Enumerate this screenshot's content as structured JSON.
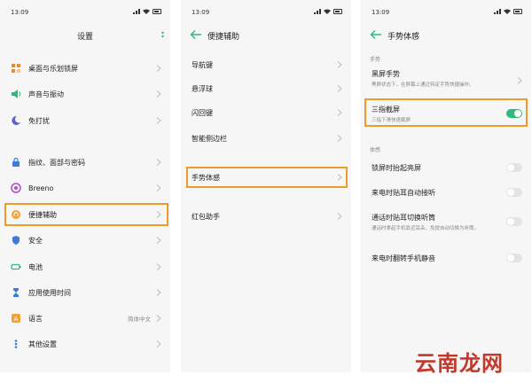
{
  "status": {
    "time": "13:09"
  },
  "screen1": {
    "title": "设置",
    "items": [
      {
        "label": "桌面与乐划锁屏",
        "icon": "desktop-icon",
        "color": "#f08a2c"
      },
      {
        "label": "声音与振动",
        "icon": "sound-icon",
        "color": "#2fb97b"
      },
      {
        "label": "免打扰",
        "icon": "moon-icon",
        "color": "#5a64c8"
      },
      {
        "label": "指纹、面部与密码",
        "icon": "lock-icon",
        "color": "#3d7bd9"
      },
      {
        "label": "Breeno",
        "icon": "breeno-icon",
        "color": "#b34cc6"
      },
      {
        "label": "便捷辅助",
        "icon": "assist-icon",
        "color": "#f0a13a"
      },
      {
        "label": "安全",
        "icon": "shield-icon",
        "color": "#3d7bd9"
      },
      {
        "label": "电池",
        "icon": "battery-icon",
        "color": "#2fb97b"
      },
      {
        "label": "应用使用时间",
        "icon": "hourglass-icon",
        "color": "#3d7bd9"
      },
      {
        "label": "语言",
        "icon": "language-icon",
        "color": "#f0a13a",
        "value": "简体中文"
      },
      {
        "label": "其他设置",
        "icon": "dots-icon",
        "color": "#3d7bd9"
      }
    ]
  },
  "screen2": {
    "title": "便捷辅助",
    "items": [
      {
        "label": "导航键"
      },
      {
        "label": "悬浮球"
      },
      {
        "label": "闪回键"
      },
      {
        "label": "智能侧边栏"
      },
      {
        "label": "手势体感"
      },
      {
        "label": "红包助手"
      }
    ]
  },
  "screen3": {
    "title": "手势体感",
    "section1": "手势",
    "black_gesture": {
      "label": "黑屏手势",
      "sub": "黑屏状态下，在屏幕上通过特定手势快捷操作。"
    },
    "three_finger": {
      "label": "三指截屏",
      "sub": "三指下滑快速截屏",
      "on": true
    },
    "section2": "体感",
    "toggles": [
      {
        "label": "锁屏时抬起亮屏",
        "on": false
      },
      {
        "label": "来电时贴耳自动接听",
        "on": false
      },
      {
        "label": "通话时贴耳切换听筒",
        "sub": "通话时拿起手机靠近耳朵，免提自动切换为听筒。",
        "on": false
      },
      {
        "label": "来电时翻转手机静音",
        "on": false
      }
    ]
  },
  "watermark": "云南龙网",
  "colors": {
    "highlight": "#ef9b2a",
    "toggle_on": "#2fb97b",
    "accent": "#2fb97b"
  }
}
